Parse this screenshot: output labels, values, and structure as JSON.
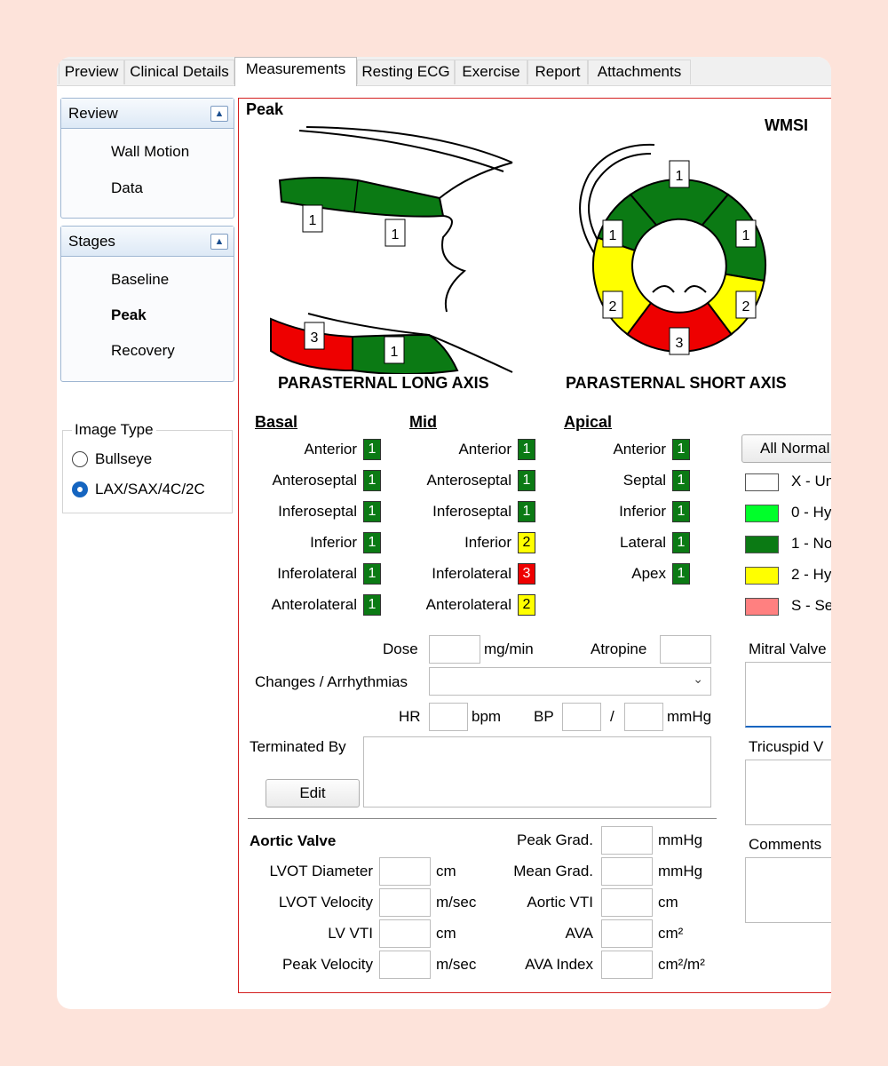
{
  "tabs": [
    "Preview",
    "Clinical Details",
    "Measurements",
    "Resting ECG",
    "Exercise",
    "Report",
    "Attachments"
  ],
  "sidebar": {
    "review": {
      "title": "Review",
      "items": [
        "Wall Motion",
        "Data"
      ]
    },
    "stages": {
      "title": "Stages",
      "items": [
        "Baseline",
        "Peak",
        "Recovery"
      ],
      "selected": "Peak"
    },
    "image_type": {
      "title": "Image Type",
      "options": [
        "Bullseye",
        "LAX/SAX/4C/2C"
      ],
      "selected": "LAX/SAX/4C/2C"
    }
  },
  "main": {
    "stage_title": "Peak",
    "wmsi_label": "WMSI",
    "lax_label": "PARASTERNAL LONG AXIS",
    "sax_label": "PARASTERNAL SHORT AXIS",
    "lax_scores": [
      "1",
      "1",
      "3",
      "1"
    ],
    "sax_scores": [
      "1",
      "1",
      "1",
      "2",
      "2",
      "3"
    ],
    "segments": {
      "basal": {
        "title": "Basal",
        "rows": [
          {
            "name": "Anterior",
            "score": "1"
          },
          {
            "name": "Anteroseptal",
            "score": "1"
          },
          {
            "name": "Inferoseptal",
            "score": "1"
          },
          {
            "name": "Inferior",
            "score": "1"
          },
          {
            "name": "Inferolateral",
            "score": "1"
          },
          {
            "name": "Anterolateral",
            "score": "1"
          }
        ]
      },
      "mid": {
        "title": "Mid",
        "rows": [
          {
            "name": "Anterior",
            "score": "1"
          },
          {
            "name": "Anteroseptal",
            "score": "1"
          },
          {
            "name": "Inferoseptal",
            "score": "1"
          },
          {
            "name": "Inferior",
            "score": "2"
          },
          {
            "name": "Inferolateral",
            "score": "3"
          },
          {
            "name": "Anterolateral",
            "score": "2"
          }
        ]
      },
      "apical": {
        "title": "Apical",
        "rows": [
          {
            "name": "Anterior",
            "score": "1"
          },
          {
            "name": "Septal",
            "score": "1"
          },
          {
            "name": "Inferior",
            "score": "1"
          },
          {
            "name": "Lateral",
            "score": "1"
          },
          {
            "name": "Apex",
            "score": "1"
          }
        ]
      }
    },
    "all_normal": "All Normal",
    "legend": [
      {
        "label": "X - Un",
        "color": "#ffffff"
      },
      {
        "label": "0 - Hy",
        "color": "#00ff2a"
      },
      {
        "label": "1 - No",
        "color": "#0b7a14"
      },
      {
        "label": "2 - Hy",
        "color": "#ffff00"
      },
      {
        "label": "S - Se",
        "color": "#ff8080"
      }
    ],
    "form": {
      "dose": "Dose",
      "dose_unit": "mg/min",
      "atropine": "Atropine",
      "changes": "Changes / Arrhythmias",
      "hr": "HR",
      "hr_unit": "bpm",
      "bp": "BP",
      "bp_sep": "/",
      "bp_unit": "mmHg",
      "terminated_by": "Terminated By",
      "edit": "Edit"
    },
    "right_fields": {
      "mitral": "Mitral Valve",
      "tricuspid": "Tricuspid V",
      "comments": "Comments"
    },
    "aortic": {
      "title": "Aortic Valve",
      "left": [
        {
          "label": "LVOT Diameter",
          "unit": "cm"
        },
        {
          "label": "LVOT Velocity",
          "unit": "m/sec"
        },
        {
          "label": "LV VTI",
          "unit": "cm"
        },
        {
          "label": "Peak Velocity",
          "unit": "m/sec"
        }
      ],
      "right": [
        {
          "label": "Peak Grad.",
          "unit": "mmHg"
        },
        {
          "label": "Mean Grad.",
          "unit": "mmHg"
        },
        {
          "label": "Aortic VTI",
          "unit": "cm"
        },
        {
          "label": "AVA",
          "unit": "cm²"
        },
        {
          "label": "AVA Index",
          "unit": "cm²/m²"
        }
      ]
    }
  }
}
